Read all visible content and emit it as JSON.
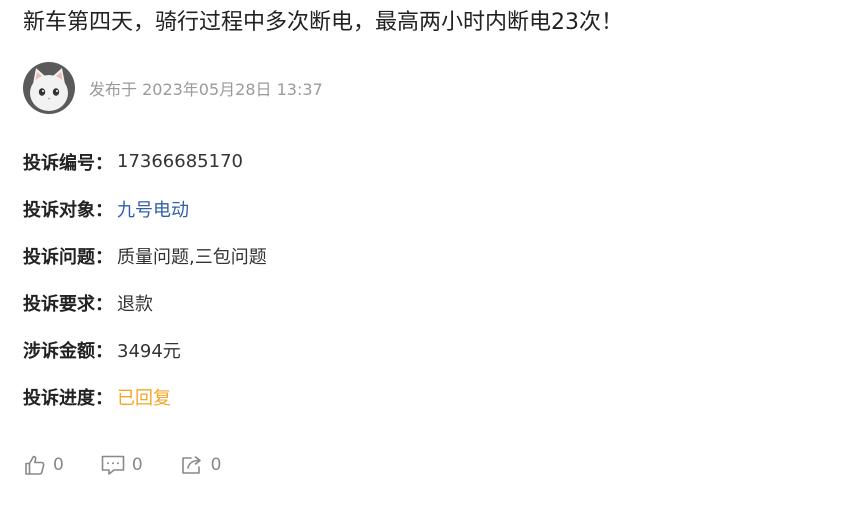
{
  "post": {
    "title": "新车第四天，骑行过程中多次断电，最高两小时内断电23次！",
    "published": "发布于 2023年05月28日 13:37",
    "avatar_icon": "cat-avatar-icon"
  },
  "complaint": {
    "rows": [
      {
        "label": "投诉编号：",
        "value": "17366685170"
      },
      {
        "label": "投诉对象：",
        "value": "九号电动"
      },
      {
        "label": "投诉问题：",
        "value": "质量问题,三包问题"
      },
      {
        "label": "投诉要求：",
        "value": "退款"
      },
      {
        "label": "涉诉金额：",
        "value": "3494元"
      },
      {
        "label": "投诉进度：",
        "value": "已回复"
      }
    ]
  },
  "actions": {
    "like": {
      "icon": "thumbs-up-icon",
      "count": "0"
    },
    "comment": {
      "icon": "comment-icon",
      "count": "0"
    },
    "share": {
      "icon": "share-icon",
      "count": "0"
    }
  },
  "colors": {
    "link": "#2f5fa8",
    "status": "#f5a623",
    "muted": "#9a9a9a"
  }
}
